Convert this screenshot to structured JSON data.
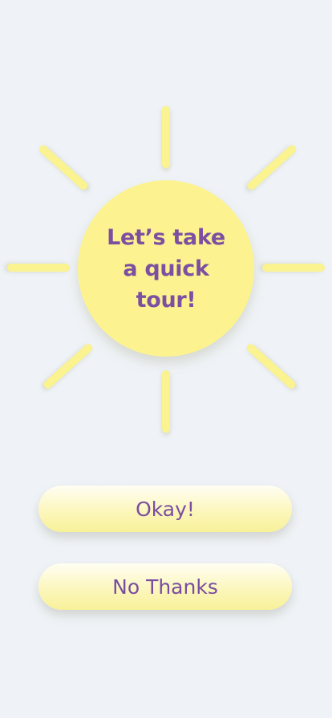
{
  "intro": {
    "headline": "Let’s take a quick tour!"
  },
  "buttons": {
    "ok_label": "Okay!",
    "no_label": "No Thanks"
  },
  "colors": {
    "background": "#eff3f7",
    "sun": "#fcf390",
    "text": "#7c4fa0"
  },
  "icons": {
    "sun": "sun-icon"
  }
}
